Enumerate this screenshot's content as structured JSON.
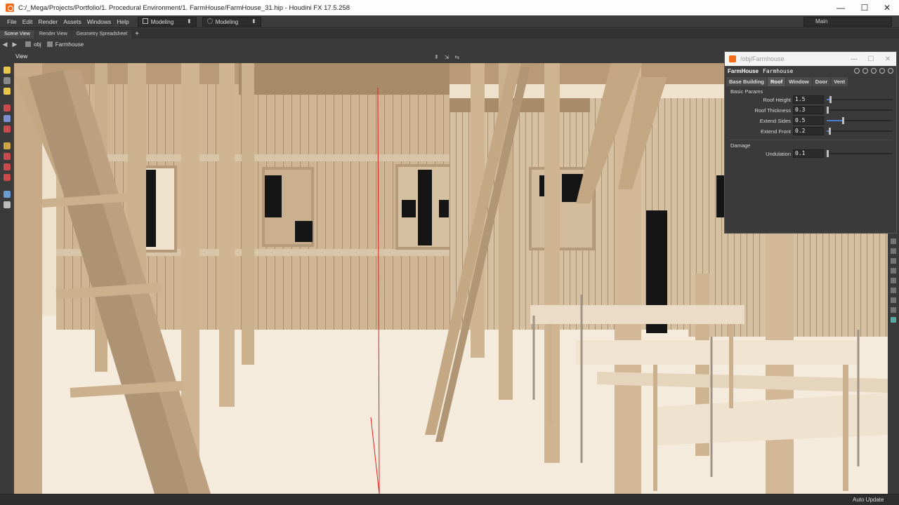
{
  "window": {
    "title": "C:/_Mega/Projects/Portfolio/1. Procedural Environment/1. FarmHouse/FarmHouse_31.hip - Houdini FX 17.5.258",
    "controls": [
      "—",
      "☐",
      "✕"
    ]
  },
  "menubar": {
    "menus": [
      "File",
      "Edit",
      "Render",
      "Assets",
      "Windows",
      "Help"
    ],
    "desktop": "Modeling",
    "shelf": "Modeling",
    "desktop_main": "Main"
  },
  "tabs": [
    "Scene View",
    "Render View",
    "Geometry Spreadsheet"
  ],
  "pathbar": {
    "root": "obj",
    "node": "Farmhouse"
  },
  "viewer": {
    "label": "View"
  },
  "status": {
    "auto_update": "Auto Update"
  },
  "panel": {
    "path": "/obj/Farmhouse",
    "node_type": "FarmHouse",
    "node_name": "Farmhouse",
    "tabs": [
      "Base Building",
      "Roof",
      "Window",
      "Door",
      "Vent"
    ],
    "active_tab": "Roof",
    "sections": [
      {
        "title": "Basic Params",
        "params": [
          {
            "label": "Roof Height",
            "value": "1.5",
            "fraction": 0.05
          },
          {
            "label": "Roof Thickness",
            "value": "0.3",
            "fraction": 0.0
          },
          {
            "label": "Extend Sides",
            "value": "0.5",
            "fraction": 0.24
          },
          {
            "label": "Extend Front",
            "value": "0.2",
            "fraction": 0.04
          }
        ]
      },
      {
        "title": "Damage",
        "params": [
          {
            "label": "Undulation",
            "value": "0.1",
            "fraction": 0.0
          }
        ]
      }
    ]
  },
  "colors": {
    "wood": "#cdb392",
    "wood_dark": "#9c8466",
    "floor": "#f4e8d8",
    "accent": "#f06a1a",
    "slider_fill": "#4a7fd0"
  }
}
